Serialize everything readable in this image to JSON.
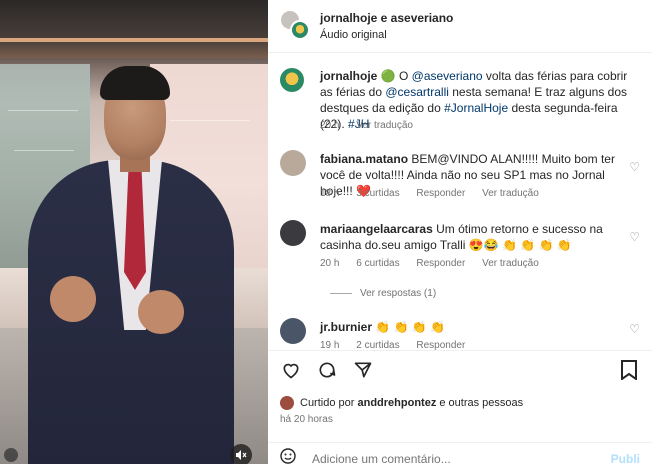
{
  "video": {
    "mute_icon": "speaker-muted-icon"
  },
  "header": {
    "title": "jornalhoje e aseveriano",
    "subtitle": "Áudio original"
  },
  "caption": {
    "author": "jornalhoje",
    "emoji": "🟢",
    "text_pre": "O ",
    "mention1": "@aseveriano",
    "text_mid1": " volta das férias para cobrir as férias do ",
    "mention2": "@cesartralli",
    "text_mid2": " nesta semana! E traz alguns dos destques da edição do ",
    "hashtag1": "#JornalHoje",
    "text_mid3": " desta segunda-feira (22). ",
    "hashtag2": "#JH",
    "time": "20 h",
    "see_translation": "Ver tradução"
  },
  "comments": [
    {
      "author": "fabiana.matano",
      "text": "BEM@VINDO ALAN!!!!! Muito bom ter você de volta!!!! Ainda não no seu SP1 mas no Jornal hoje!!! ❤️",
      "time": "18 h",
      "likes": "3 curtidas",
      "reply": "Responder",
      "see_translation": "Ver tradução",
      "avatar_color": "#b8a99b"
    },
    {
      "author": "mariaangelaarcaras",
      "text": "Um ótimo retorno e sucesso na casinha do.seu amigo Tralli 😍😂 👏 👏 👏 👏",
      "time": "20 h",
      "likes": "6 curtidas",
      "reply": "Responder",
      "see_translation": "Ver tradução",
      "avatar_color": "#3b3a3f"
    },
    {
      "author": "jr.burnier",
      "text": "👏 👏 👏 👏",
      "time": "19 h",
      "likes": "2 curtidas",
      "reply": "Responder",
      "see_translation": "",
      "avatar_color": "#4b5568"
    }
  ],
  "view_replies": "Ver respostas (1)",
  "actions": {
    "like_icon": "heart-icon",
    "comment_icon": "comment-bubble-icon",
    "share_icon": "paper-plane-icon",
    "save_icon": "bookmark-icon"
  },
  "likes_text_prefix": "Curtido por ",
  "likes_user": "anddrehpontez",
  "likes_text_suffix": " e outras pessoas",
  "post_time": "há 20 horas",
  "comment_box": {
    "placeholder": "Adicione um comentário...",
    "publish_label": "Publi"
  }
}
